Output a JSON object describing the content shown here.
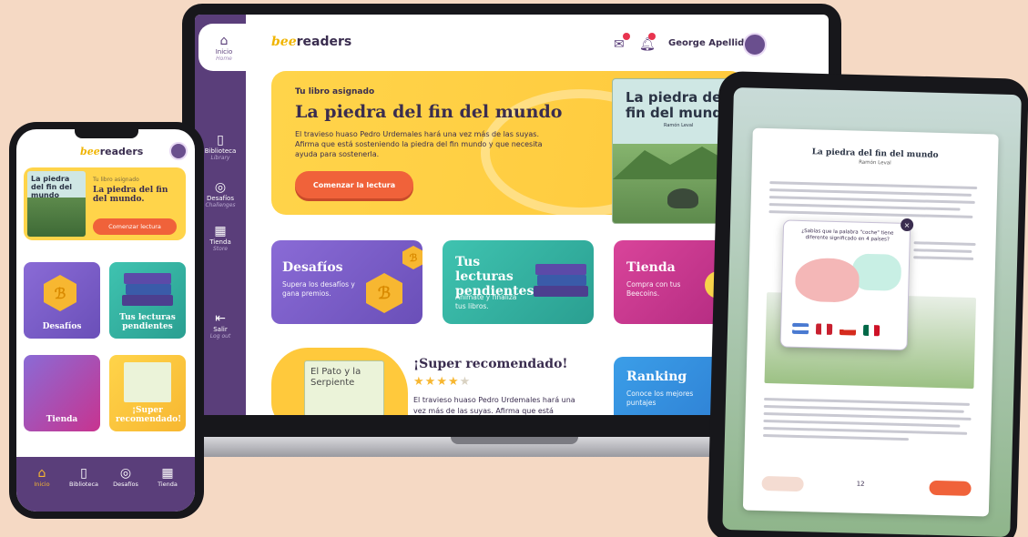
{
  "app": {
    "brand_bee": "bee",
    "brand_rest": "readers"
  },
  "laptop": {
    "sidebar": {
      "home_label": "Inicio",
      "home_sub": "Home",
      "items": [
        {
          "label": "Biblioteca",
          "sub": "Library",
          "icon": "library-icon"
        },
        {
          "label": "Desafíos",
          "sub": "Challenges",
          "icon": "challenges-icon"
        },
        {
          "label": "Tienda",
          "sub": "Store",
          "icon": "store-icon"
        }
      ],
      "logout_label": "Salir",
      "logout_sub": "Log out"
    },
    "header": {
      "user_name": "George Apellido"
    },
    "hero": {
      "kicker": "Tu libro asignado",
      "title": "La piedra del fin del mundo",
      "description": "El travieso huaso Pedro Urdemales hará una vez más de las suyas. Afirma que está sosteniendo la piedra del fin mundo y que necesita ayuda para sostenerla.",
      "button": "Comenzar la lectura",
      "cover_title": "La piedra del fin del mundo",
      "cover_author": "Ramón Leval"
    },
    "cards": [
      {
        "title": "Desafíos",
        "desc": "Supera los desafíos y gana premios."
      },
      {
        "title": "Tus lecturas pendientes",
        "desc": "Anímate y finaliza tus libros."
      },
      {
        "title": "Tienda",
        "desc": "Compra con tus Beecoins."
      }
    ],
    "recommended": {
      "title": "¡Super recomendado!",
      "rating": 4,
      "rating_max": 5,
      "book_title": "El Pato y la Serpiente",
      "desc": "El travieso huaso Pedro Urdemales hará una vez más de las suyas. Afirma que está"
    },
    "ranking": {
      "title": "Ranking",
      "desc": "Conoce los mejores puntajes"
    }
  },
  "phone": {
    "hero": {
      "cover_title": "La piedra del fin del mundo",
      "kicker": "Tu libro asignado",
      "title": "La piedra del fin del mundo.",
      "button": "Comenzar lectura"
    },
    "tiles": [
      {
        "label": "Desafíos"
      },
      {
        "label": "Tus lecturas pendientes"
      },
      {
        "label": "Tienda"
      },
      {
        "label": "¡Super recomendado!"
      }
    ],
    "nav": [
      {
        "label": "Inicio",
        "icon": "home-icon"
      },
      {
        "label": "Biblioteca",
        "icon": "library-icon"
      },
      {
        "label": "Desafíos",
        "icon": "challenges-icon"
      },
      {
        "label": "Tienda",
        "icon": "store-icon"
      }
    ]
  },
  "tablet": {
    "reader": {
      "title": "La piedra del fin del mundo",
      "author": "Ramón Leval",
      "popup_question": "¿Sabías que la palabra \"coche\" tiene diferente significado en 4 países?",
      "page_number": "12"
    }
  },
  "colors": {
    "background": "#f5d9c4",
    "primary_purple": "#5a3e7a",
    "accent_yellow": "#ffc93c",
    "accent_orange": "#f0623a",
    "card_challenges": "#7b5fc8",
    "card_pending": "#32b7a6",
    "card_store": "#c8338f",
    "card_ranking": "#2d7dd2"
  }
}
